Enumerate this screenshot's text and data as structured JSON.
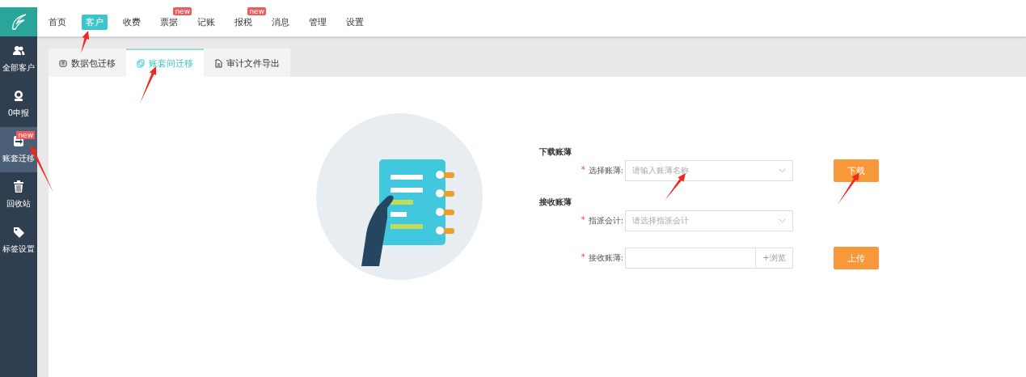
{
  "top_nav": [
    {
      "label": "首页",
      "selected": false
    },
    {
      "label": "客户",
      "selected": true
    },
    {
      "label": "收费",
      "selected": false
    },
    {
      "label": "票据",
      "selected": false,
      "badge": "new"
    },
    {
      "label": "记账",
      "selected": false
    },
    {
      "label": "报税",
      "selected": false,
      "badge": "new"
    },
    {
      "label": "消息",
      "selected": false
    },
    {
      "label": "管理",
      "selected": false
    },
    {
      "label": "设置",
      "selected": false
    }
  ],
  "sidebar": {
    "items": [
      {
        "kind": "users",
        "label": "全部客户",
        "selected": false
      },
      {
        "kind": "coin",
        "label": "0申报",
        "selected": false
      },
      {
        "kind": "transfer",
        "label": "账套迁移",
        "selected": true,
        "badge": "new"
      },
      {
        "kind": "trash",
        "label": "回收站",
        "selected": false
      },
      {
        "kind": "tag",
        "label": "标签设置",
        "selected": false
      }
    ]
  },
  "tabs": [
    {
      "kind": "package",
      "label": "数据包迁移",
      "selected": false
    },
    {
      "kind": "copy",
      "label": "账套间迁移",
      "selected": true
    },
    {
      "kind": "file",
      "label": "审计文件导出",
      "selected": false
    }
  ],
  "form": {
    "sections": [
      {
        "title": "下载账薄",
        "rows": [
          {
            "kind": "select",
            "mark": "*",
            "label": "选择账薄:",
            "placeholder": "请输入账薄名称",
            "button": "下载"
          }
        ]
      },
      {
        "title": "接收账薄",
        "rows": [
          {
            "kind": "select",
            "mark": "*",
            "label": "指派会计:",
            "placeholder": "请选择指派会计"
          },
          {
            "kind": "file",
            "mark": "*",
            "label": "接收账薄:",
            "browse": "+浏览",
            "button": "上传"
          }
        ]
      }
    ]
  }
}
